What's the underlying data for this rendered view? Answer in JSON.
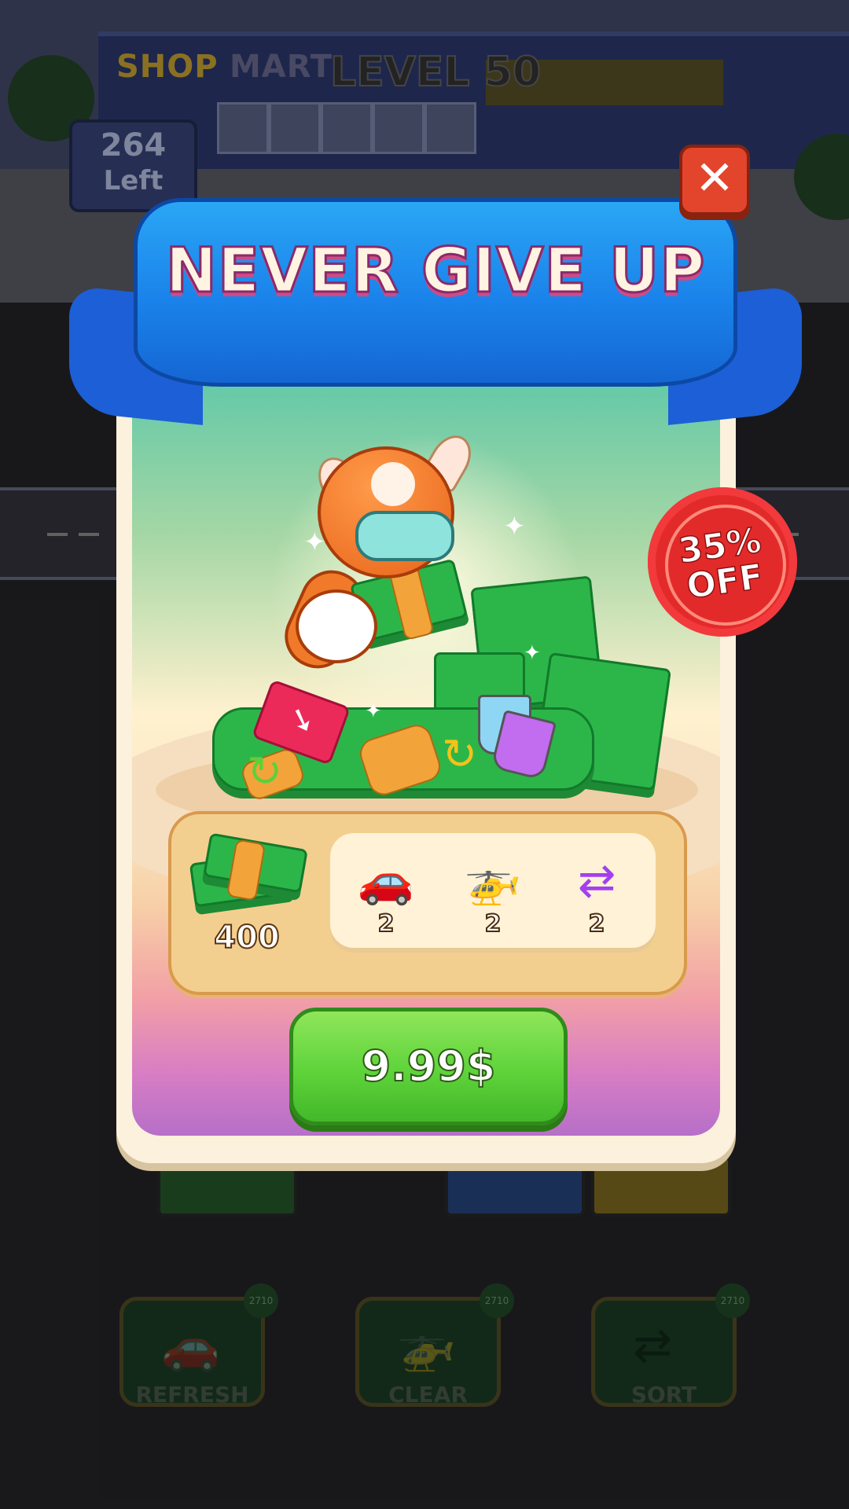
{
  "game": {
    "level_label": "LEVEL 50",
    "shop_sign_left": "SHOP",
    "shop_sign_right": "MART",
    "remaining_count": "264",
    "remaining_label": "Left"
  },
  "powerups": [
    {
      "label": "REFRESH",
      "count": "2710",
      "icon": "refresh-car-icon"
    },
    {
      "label": "CLEAR",
      "count": "2710",
      "icon": "helicopter-icon"
    },
    {
      "label": "SORT",
      "count": "2710",
      "icon": "sort-person-icon"
    }
  ],
  "popup": {
    "title": "NEVER GIVE UP",
    "close_icon": "close-icon",
    "discount_line1": "35%",
    "discount_line2": "OFF",
    "rewards": {
      "cash_amount": "400",
      "boosts": [
        {
          "icon": "refresh-car-icon",
          "count": "2"
        },
        {
          "icon": "helicopter-icon",
          "count": "2"
        },
        {
          "icon": "sort-person-icon",
          "count": "2"
        }
      ]
    },
    "price_label": "9.99$"
  },
  "colors": {
    "ribbon": "#1a82ea",
    "buy_button": "#5ed33a",
    "discount_badge": "#e32a2a",
    "close_button": "#e2452c"
  }
}
